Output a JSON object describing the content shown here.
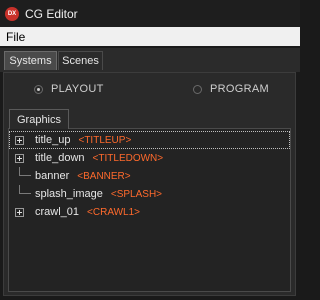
{
  "window": {
    "title": "CG Editor",
    "icon_label": "DX",
    "icon": "app-logo-icon"
  },
  "menu": {
    "items": [
      "File"
    ]
  },
  "tabs": [
    {
      "label": "Systems",
      "active": true
    },
    {
      "label": "Scenes",
      "active": false
    }
  ],
  "output_mode": {
    "options": [
      {
        "label": "PLAYOUT",
        "selected": true
      },
      {
        "label": "PROGRAM",
        "selected": false
      }
    ]
  },
  "graphics_tab": {
    "label": "Graphics"
  },
  "tree": {
    "items": [
      {
        "name": "title_up",
        "tag": "<TITLEUP>",
        "expandable": true,
        "selected": true
      },
      {
        "name": "title_down",
        "tag": "<TITLEDOWN>",
        "expandable": true,
        "selected": false
      },
      {
        "name": "banner",
        "tag": "<BANNER>",
        "expandable": false,
        "selected": false
      },
      {
        "name": "splash_image",
        "tag": "<SPLASH>",
        "expandable": false,
        "selected": false
      },
      {
        "name": "crawl_01",
        "tag": "<CRAWL1>",
        "expandable": true,
        "selected": false
      }
    ]
  },
  "colors": {
    "tag": "#ff6a2c",
    "icon": "#c8312a",
    "background": "#1a1a1a"
  }
}
